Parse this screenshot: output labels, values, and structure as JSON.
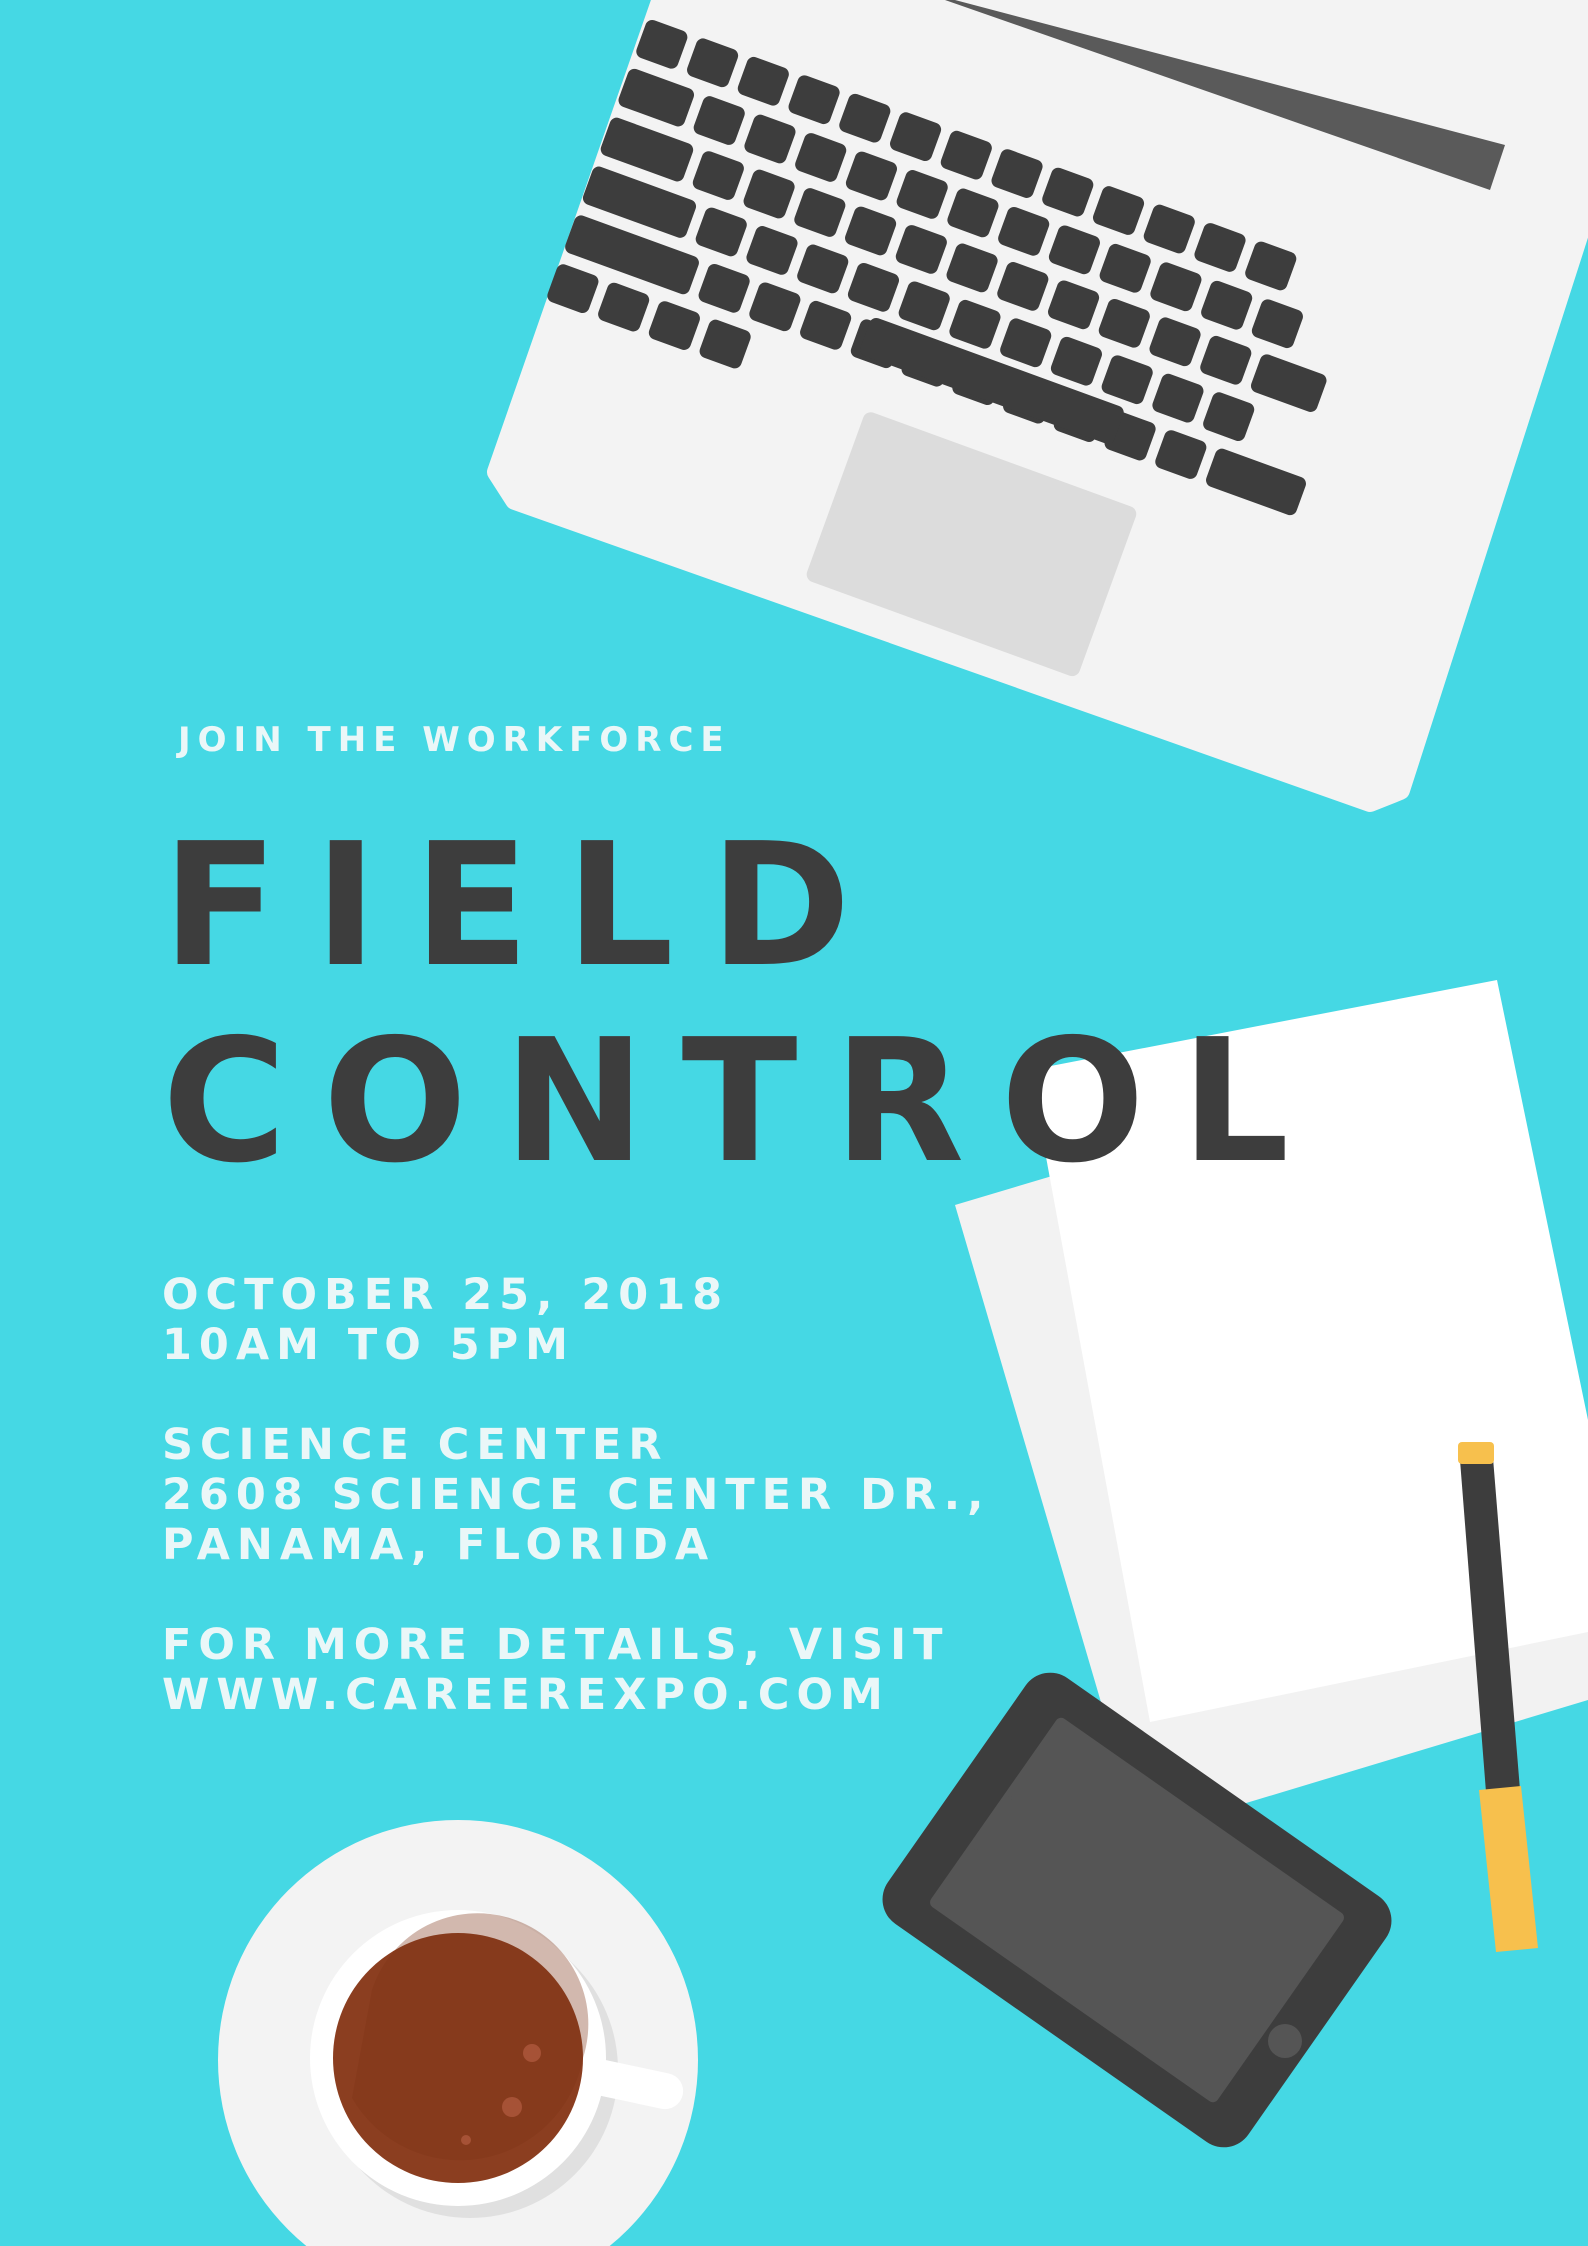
{
  "poster": {
    "eyebrow": "JOIN THE WORKFORCE",
    "title_line1": "FIELD",
    "title_line2": "CONTROL",
    "date": "OCTOBER 25, 2018",
    "time": "10AM TO 5PM",
    "venue_name": "SCIENCE CENTER",
    "venue_street": "2608 SCIENCE CENTER DR.,",
    "venue_city": "PANAMA, FLORIDA",
    "details_label": "FOR MORE DETAILS, VISIT",
    "details_url": "WWW.CAREEREXPO.COM"
  },
  "colors": {
    "background": "#45d8e4",
    "title": "#3d3d3d",
    "info_text": "#eaf7f8",
    "laptop": "#f3f3f3",
    "keys": "#3d3d3d",
    "pencil_accent": "#f7c04d",
    "coffee": "#8b3e20"
  },
  "illustrations": [
    "laptop-illustration",
    "paper-illustration",
    "pencil-illustration",
    "phone-illustration",
    "coffee-cup-illustration"
  ]
}
